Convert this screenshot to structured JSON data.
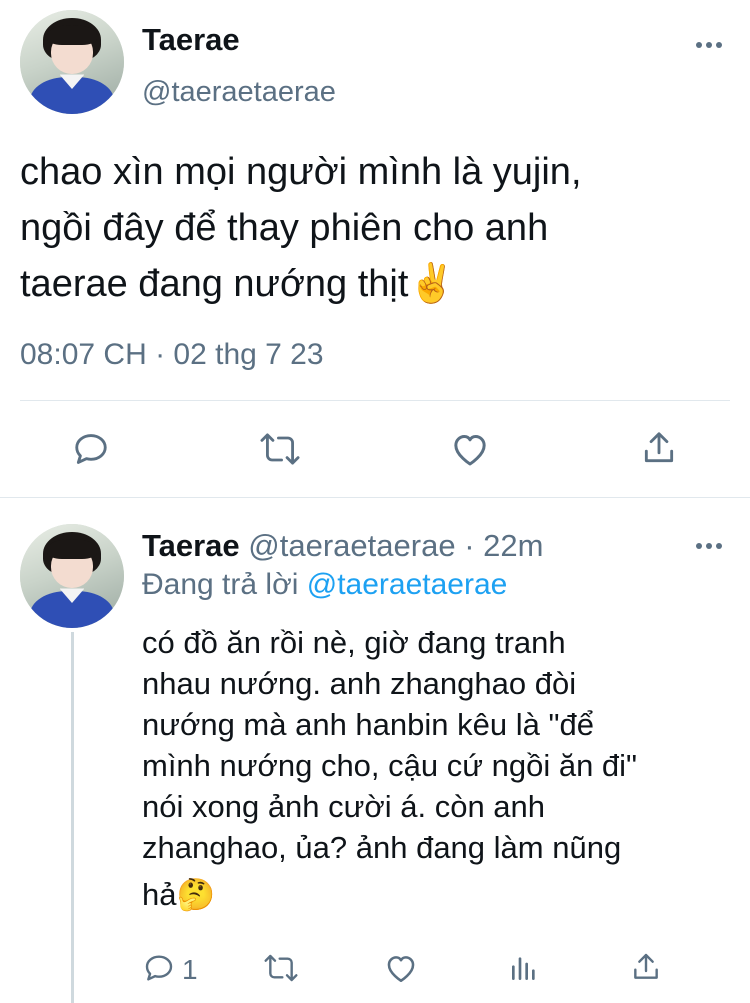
{
  "tweet": {
    "author": {
      "name": "Taerae",
      "handle": "@taeraetaerae",
      "avatar_icon": "profile-photo"
    },
    "text_lines": [
      "chao xìn mọi người mình là yujin,",
      "ngồi đây để thay phiên cho anh",
      "taerae đang nướng thịt✌️"
    ],
    "timestamp": "08:07 CH · 02 thg 7 23",
    "actions": [
      "reply-icon",
      "retweet-icon",
      "like-icon",
      "share-icon"
    ]
  },
  "reply": {
    "author": {
      "name": "Taerae",
      "handle": "@taeraetaerae",
      "time": "· 22m",
      "avatar_icon": "profile-photo"
    },
    "replying_prefix": "Đang trả lời",
    "replying_to": "@taeraetaerae",
    "text_lines": [
      "có đồ ăn rồi nè, giờ đang tranh",
      "nhau nướng. anh zhanghao đòi",
      "nướng mà anh hanbin kêu là \"để",
      "mình nướng cho, cậu cứ ngồi ăn đi\"",
      "nói xong ảnh cười á. còn anh",
      "zhanghao, ủa? ảnh đang làm nũng",
      "hả🤔"
    ],
    "reply_count": "1",
    "actions": [
      "reply-icon",
      "retweet-icon",
      "like-icon",
      "analytics-icon",
      "share-icon"
    ]
  },
  "colors": {
    "text": "#0f1419",
    "secondary": "#5b7083",
    "link": "#1da1f2",
    "divider": "#e1e8ed"
  }
}
